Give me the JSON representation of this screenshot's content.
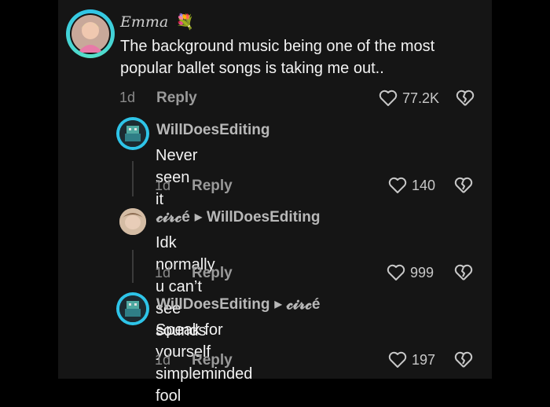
{
  "comments": [
    {
      "author": "Emma",
      "emoji": "💐",
      "text": "The background music being one of the most popular ballet songs is taking me out..",
      "age": "1d",
      "reply_label": "Reply",
      "likes": "77.2K"
    },
    {
      "author": "WillDoesEditing",
      "text": "Never seen it",
      "age": "1d",
      "reply_label": "Reply",
      "likes": "140"
    },
    {
      "author": "𝓬𝓲𝓻𝓬é",
      "reply_to": "WillDoesEditing",
      "text": "Idk normally u can’t see sounds",
      "age": "1d",
      "reply_label": "Reply",
      "likes": "999"
    },
    {
      "author": "WillDoesEditing",
      "reply_to": "𝓬𝓲𝓻𝓬é",
      "text": "Speak for yourself simpleminded fool",
      "age": "1d",
      "reply_label": "Reply",
      "likes": "197"
    }
  ],
  "colors": {
    "background": "#000000",
    "panel": "#151515",
    "avatar_ring": "#2ec4e8"
  },
  "icons": [
    "heart-icon",
    "broken-heart-icon",
    "reply-arrow-icon"
  ]
}
